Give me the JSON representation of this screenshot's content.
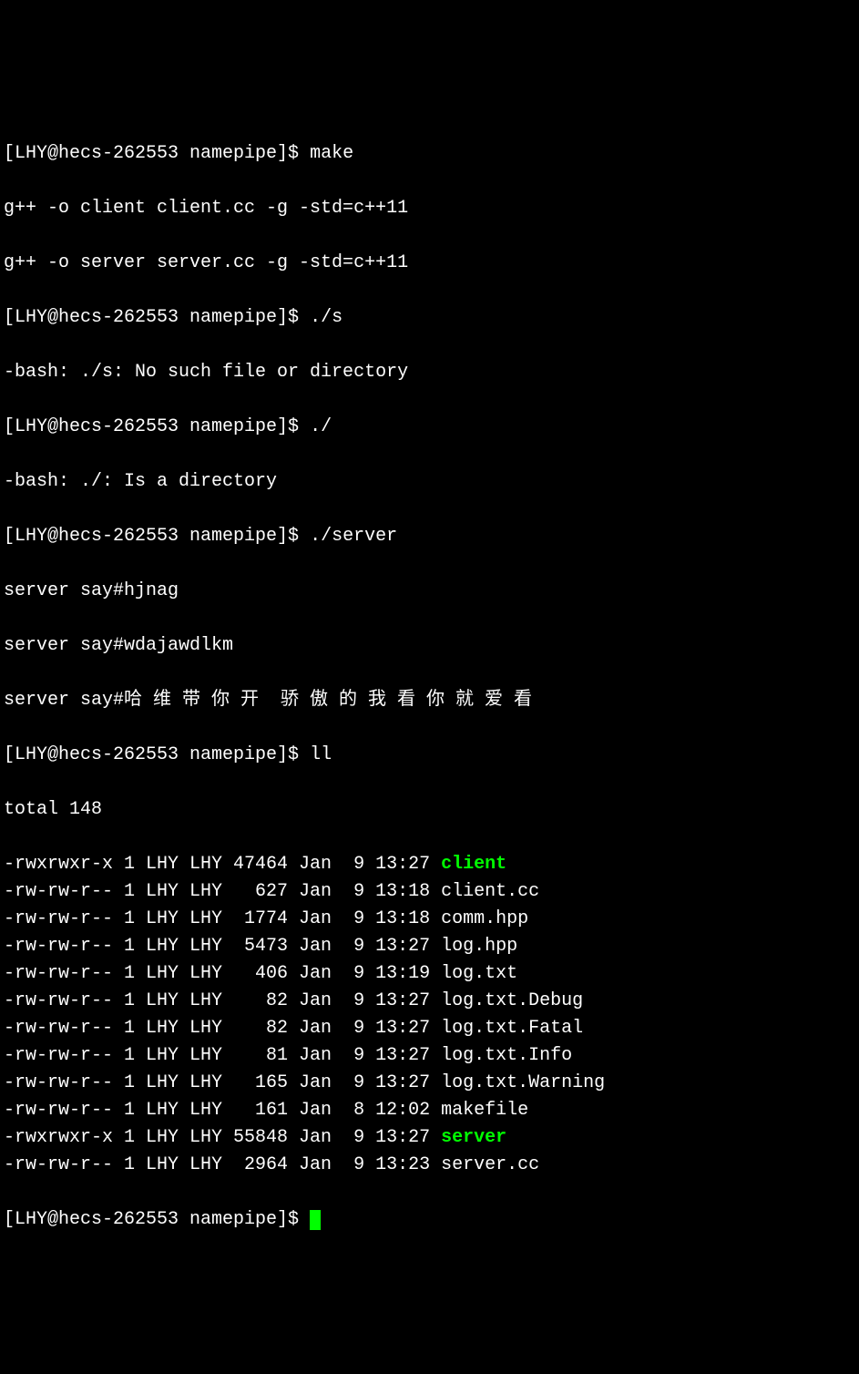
{
  "prompt": "[LHY@hecs-262553 namepipe]$ ",
  "commands": {
    "make": "make",
    "run_s": "./s",
    "run_dot": "./",
    "run_server": "./server",
    "ll": "ll"
  },
  "output": {
    "compile1": "g++ -o client client.cc -g -std=c++11",
    "compile2": "g++ -o server server.cc -g -std=c++11",
    "err_s": "-bash: ./s: No such file or directory",
    "err_dot": "-bash: ./: Is a directory",
    "server1": "server say#hjnag",
    "server2": "server say#wdajawdlkm",
    "server3_prefix": "server say#",
    "server3_cjk": "哈 维 带 你 开  骄 傲 的 我 看 你 就 爱 看",
    "total": "total 148"
  },
  "files": [
    {
      "perms": "-rwxrwxr-x",
      "links": "1",
      "owner": "LHY",
      "group": "LHY",
      "size": "47464",
      "month": "Jan",
      "day": " 9",
      "time": "13:27",
      "name": "client",
      "exec": true
    },
    {
      "perms": "-rw-rw-r--",
      "links": "1",
      "owner": "LHY",
      "group": "LHY",
      "size": "  627",
      "month": "Jan",
      "day": " 9",
      "time": "13:18",
      "name": "client.cc",
      "exec": false
    },
    {
      "perms": "-rw-rw-r--",
      "links": "1",
      "owner": "LHY",
      "group": "LHY",
      "size": " 1774",
      "month": "Jan",
      "day": " 9",
      "time": "13:18",
      "name": "comm.hpp",
      "exec": false
    },
    {
      "perms": "-rw-rw-r--",
      "links": "1",
      "owner": "LHY",
      "group": "LHY",
      "size": " 5473",
      "month": "Jan",
      "day": " 9",
      "time": "13:27",
      "name": "log.hpp",
      "exec": false
    },
    {
      "perms": "-rw-rw-r--",
      "links": "1",
      "owner": "LHY",
      "group": "LHY",
      "size": "  406",
      "month": "Jan",
      "day": " 9",
      "time": "13:19",
      "name": "log.txt",
      "exec": false
    },
    {
      "perms": "-rw-rw-r--",
      "links": "1",
      "owner": "LHY",
      "group": "LHY",
      "size": "   82",
      "month": "Jan",
      "day": " 9",
      "time": "13:27",
      "name": "log.txt.Debug",
      "exec": false
    },
    {
      "perms": "-rw-rw-r--",
      "links": "1",
      "owner": "LHY",
      "group": "LHY",
      "size": "   82",
      "month": "Jan",
      "day": " 9",
      "time": "13:27",
      "name": "log.txt.Fatal",
      "exec": false
    },
    {
      "perms": "-rw-rw-r--",
      "links": "1",
      "owner": "LHY",
      "group": "LHY",
      "size": "   81",
      "month": "Jan",
      "day": " 9",
      "time": "13:27",
      "name": "log.txt.Info",
      "exec": false
    },
    {
      "perms": "-rw-rw-r--",
      "links": "1",
      "owner": "LHY",
      "group": "LHY",
      "size": "  165",
      "month": "Jan",
      "day": " 9",
      "time": "13:27",
      "name": "log.txt.Warning",
      "exec": false
    },
    {
      "perms": "-rw-rw-r--",
      "links": "1",
      "owner": "LHY",
      "group": "LHY",
      "size": "  161",
      "month": "Jan",
      "day": " 8",
      "time": "12:02",
      "name": "makefile",
      "exec": false
    },
    {
      "perms": "-rwxrwxr-x",
      "links": "1",
      "owner": "LHY",
      "group": "LHY",
      "size": "55848",
      "month": "Jan",
      "day": " 9",
      "time": "13:27",
      "name": "server",
      "exec": true
    },
    {
      "perms": "-rw-rw-r--",
      "links": "1",
      "owner": "LHY",
      "group": "LHY",
      "size": " 2964",
      "month": "Jan",
      "day": " 9",
      "time": "13:23",
      "name": "server.cc",
      "exec": false
    }
  ]
}
